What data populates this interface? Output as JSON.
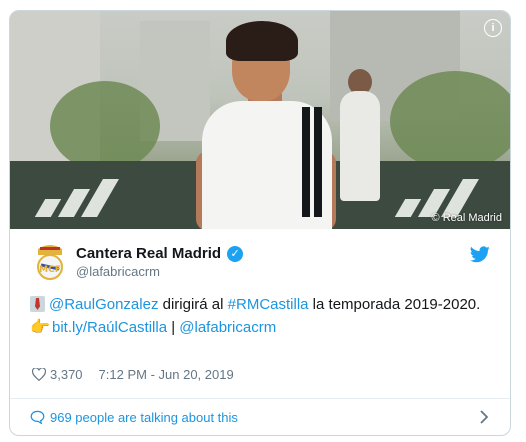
{
  "media": {
    "info_label": "i",
    "watermark": "© Real Madrid"
  },
  "author": {
    "name": "Cantera Real Madrid",
    "handle": "@lafabricacrm"
  },
  "tweet": {
    "mention": "@RaulGonzalez",
    "text_1": " dirigirá al ",
    "hashtag": "#RMCastilla",
    "text_2": " la temporada 2019-2020.",
    "link": "bit.ly/RaúlCastilla",
    "separator": " | ",
    "mention2": "@lafabricacrm",
    "point_emoji": "👉"
  },
  "meta": {
    "likes": "3,370",
    "timestamp": "7:12 PM - Jun 20, 2019"
  },
  "conversation": {
    "label": "969 people are talking about this"
  },
  "colors": {
    "accent": "#1b95e0",
    "verified": "#1da1f2",
    "muted": "#657786",
    "border": "#ccd6dd"
  },
  "icons": [
    "info-icon",
    "verified-icon",
    "twitter-bird-icon",
    "necktie-emoji-icon",
    "point-right-emoji-icon",
    "heart-icon",
    "speech-bubble-icon",
    "chevron-right-icon"
  ]
}
